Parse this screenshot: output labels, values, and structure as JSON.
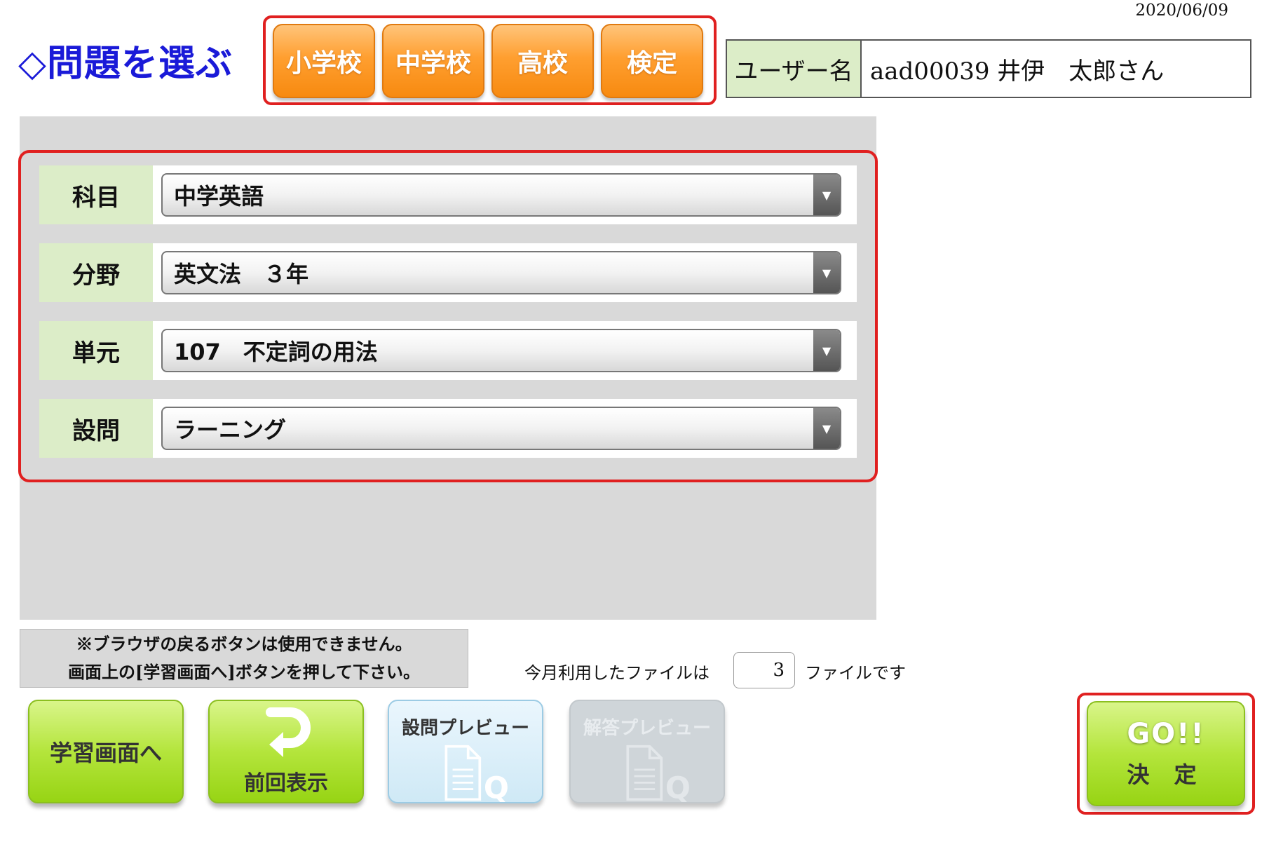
{
  "header": {
    "date": "2020/06/09",
    "page_title": "◇問題を選ぶ"
  },
  "school_tabs": [
    {
      "label": "小学校"
    },
    {
      "label": "中学校"
    },
    {
      "label": "高校"
    },
    {
      "label": "検定"
    }
  ],
  "user": {
    "label": "ユーザー名",
    "value": "aad00039 井伊　太郎さん"
  },
  "selectors": [
    {
      "label": "科目",
      "value": "中学英語"
    },
    {
      "label": "分野",
      "value": "英文法　３年"
    },
    {
      "label": "単元",
      "value": "107　不定詞の用法"
    },
    {
      "label": "設問",
      "value": "ラーニング"
    }
  ],
  "notice": {
    "line1": "※ブラウザの戻るボタンは使用できません。",
    "line2": "画面上の[学習画面へ]ボタンを押して下さい。"
  },
  "files": {
    "prefix": "今月利用したファイルは",
    "count": "3",
    "suffix": "ファイルです"
  },
  "buttons": {
    "study": "学習画面へ",
    "previous": "前回表示",
    "question_preview": "設問プレビュー",
    "answer_preview": "解答プレビュー",
    "go": "GO!!",
    "decide": "決 定"
  },
  "colors": {
    "title_blue": "#1a1ad8",
    "tab_orange": "#f78a10",
    "highlight_red": "#e02020",
    "label_green": "#dcedc8",
    "button_green": "#b4e53c",
    "panel_gray": "#d9d9d9"
  }
}
